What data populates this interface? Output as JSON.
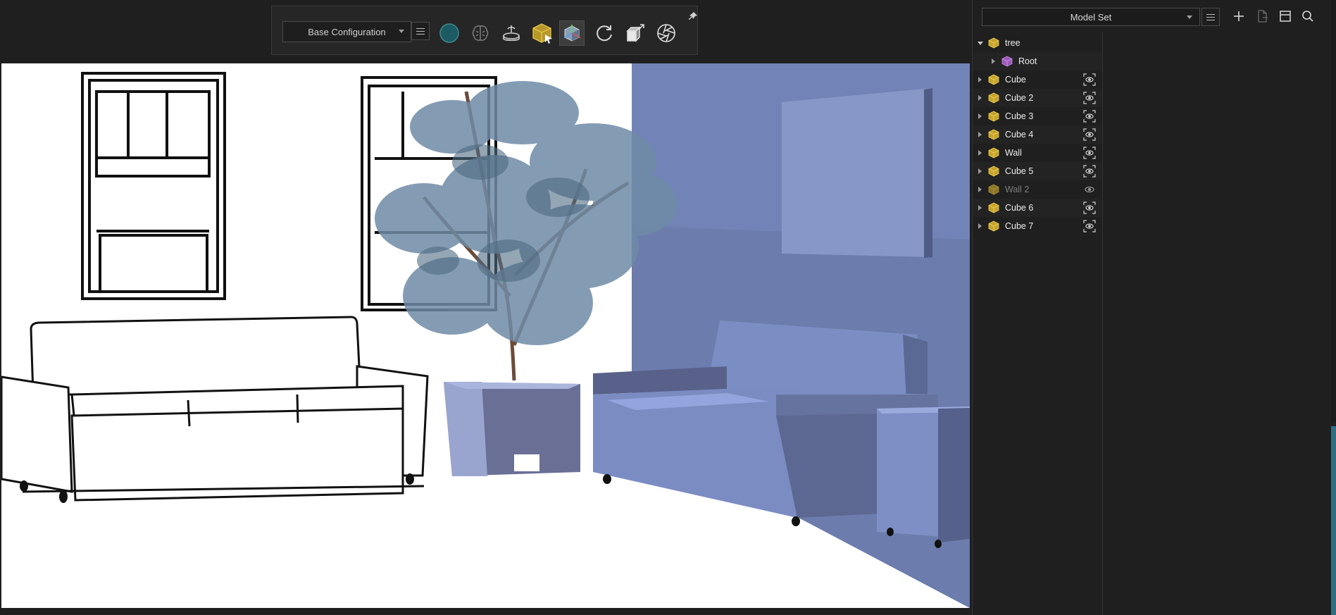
{
  "toolbar": {
    "config_select": "Base Configuration",
    "tools": [
      {
        "name": "sphere-icon"
      },
      {
        "name": "brain-icon"
      },
      {
        "name": "turntable-icon"
      },
      {
        "name": "select-cube-icon"
      },
      {
        "name": "ar-cube-icon",
        "active": true
      },
      {
        "name": "refresh-icon"
      },
      {
        "name": "cube-resize-icon"
      },
      {
        "name": "camera-aperture-icon"
      }
    ]
  },
  "panel": {
    "modelset_select": "Model Set",
    "header_icons": [
      "add-icon",
      "export-document-icon",
      "layout-window-icon",
      "search-icon"
    ]
  },
  "tree": {
    "items": [
      {
        "label": "tree",
        "expanded": true,
        "depth": 0,
        "visible_toggle": false
      },
      {
        "label": "Root",
        "expanded": false,
        "depth": 1,
        "visible_toggle": false
      },
      {
        "label": "Cube",
        "depth": 0,
        "visible_toggle": true
      },
      {
        "label": "Cube 2",
        "depth": 0,
        "visible_toggle": true
      },
      {
        "label": "Cube 3",
        "depth": 0,
        "visible_toggle": true
      },
      {
        "label": "Cube 4",
        "depth": 0,
        "visible_toggle": true
      },
      {
        "label": "Wall",
        "depth": 0,
        "visible_toggle": true
      },
      {
        "label": "Cube 5",
        "depth": 0,
        "visible_toggle": true
      },
      {
        "label": "Wall 2",
        "depth": 0,
        "visible_toggle": true,
        "dimmed": true
      },
      {
        "label": "Cube 6",
        "depth": 0,
        "visible_toggle": true
      },
      {
        "label": "Cube 7",
        "depth": 0,
        "visible_toggle": true
      }
    ]
  },
  "colors": {
    "panel_bg": "#1f1f1f",
    "scene_shade": "#7688bb",
    "accent_teal": "#2f6f82",
    "cube_yellow": "#d8b83a",
    "cube_purple": "#b06ad1"
  }
}
